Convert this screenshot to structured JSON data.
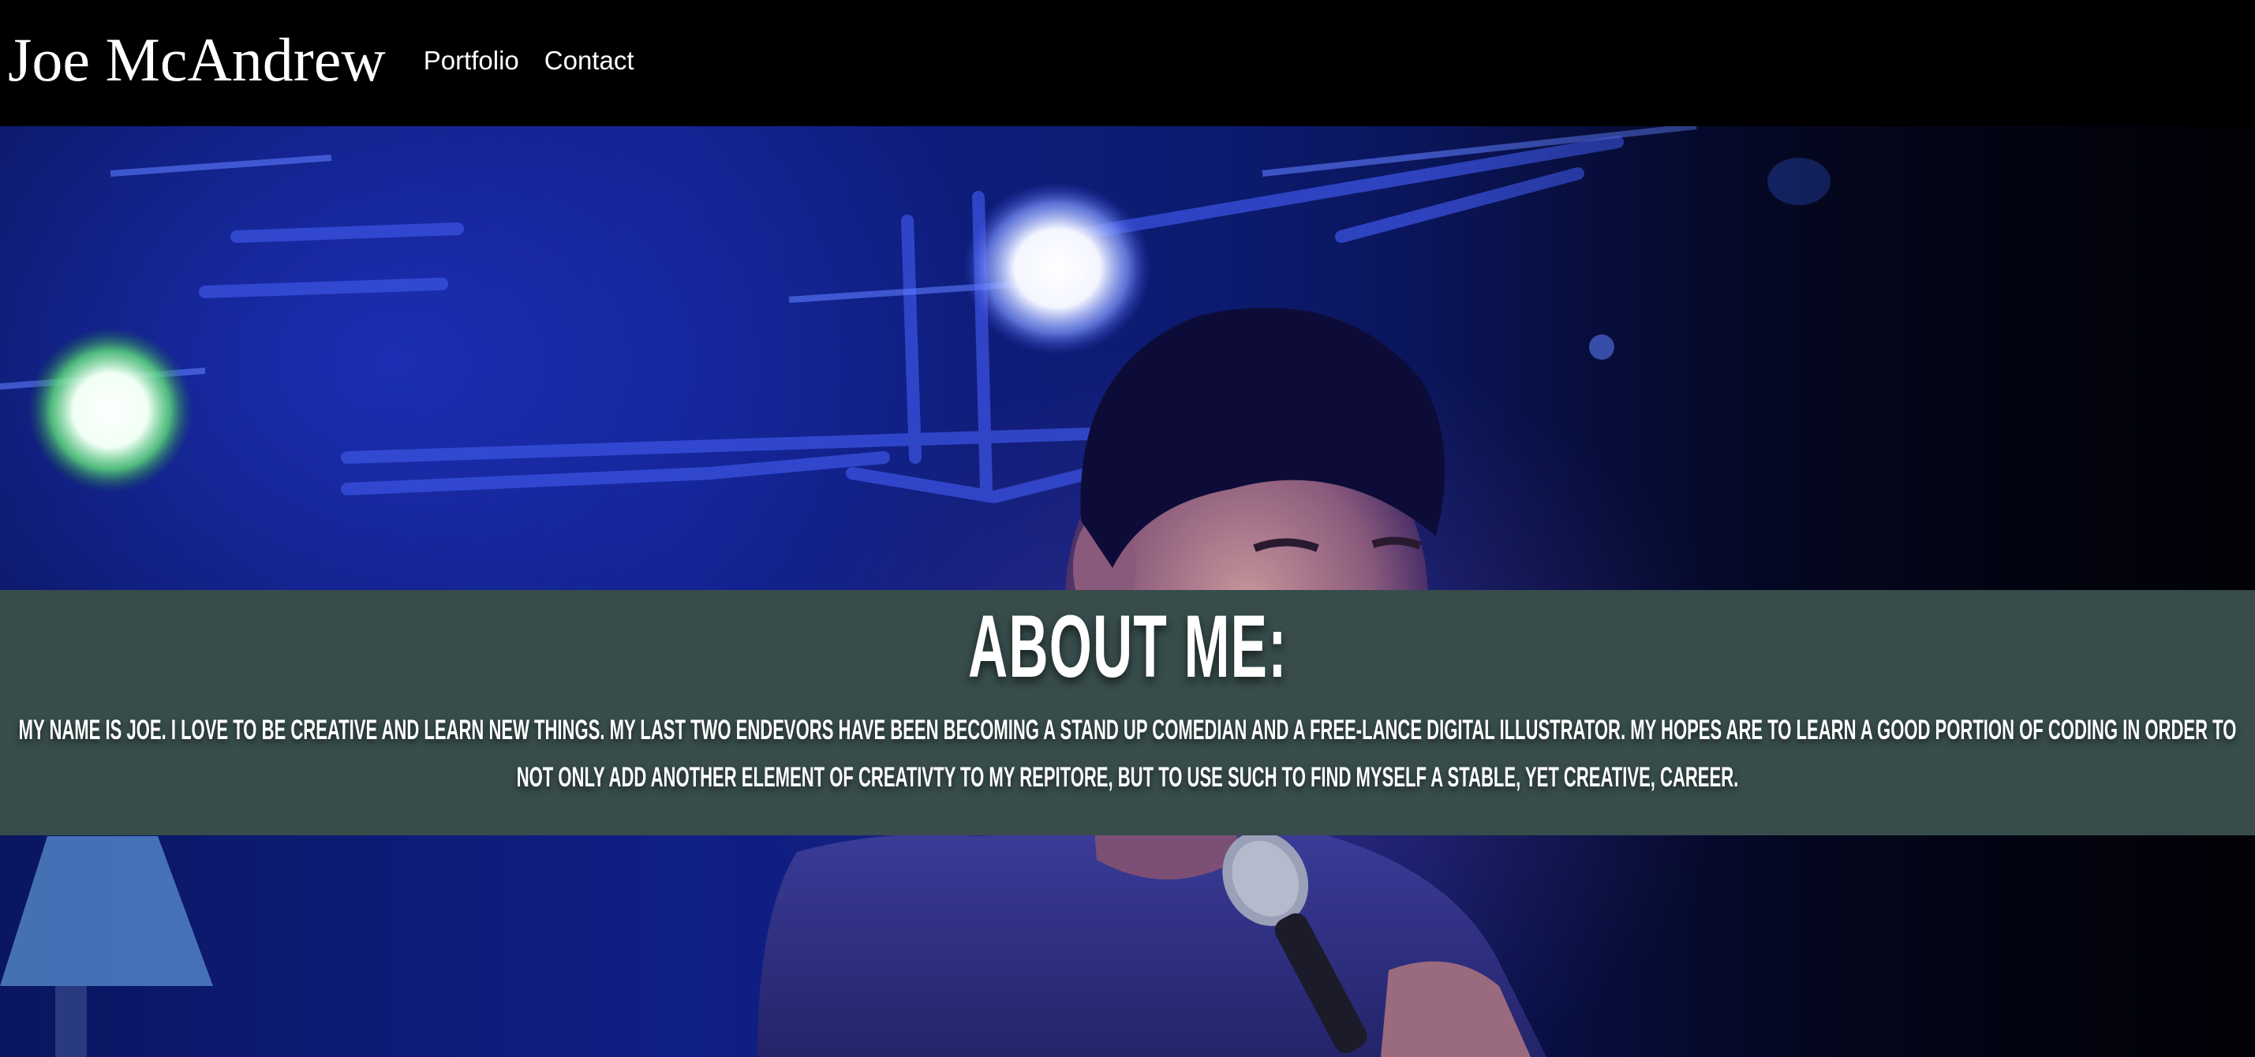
{
  "header": {
    "brand": "Joe McAndrew",
    "nav": [
      {
        "label": "Portfolio"
      },
      {
        "label": "Contact"
      }
    ]
  },
  "about": {
    "title": "About Me:",
    "body": "My name is Joe. I love to be creative and learn new things. My last two endevors have been becoming a stand up comedian and a free-lance digital illustrator. My hopes are to learn a good portion of coding in order to not only add another element of creativty to my repitore, but to use such to find myself a stable, yet creative, career."
  },
  "hero": {
    "photo": "comedian-performing-with-microphone-on-stage"
  },
  "colors": {
    "header_bg": "#000000",
    "about_band": "#374c4b",
    "text": "#ffffff",
    "stage_blue": "#1a2aa8"
  }
}
